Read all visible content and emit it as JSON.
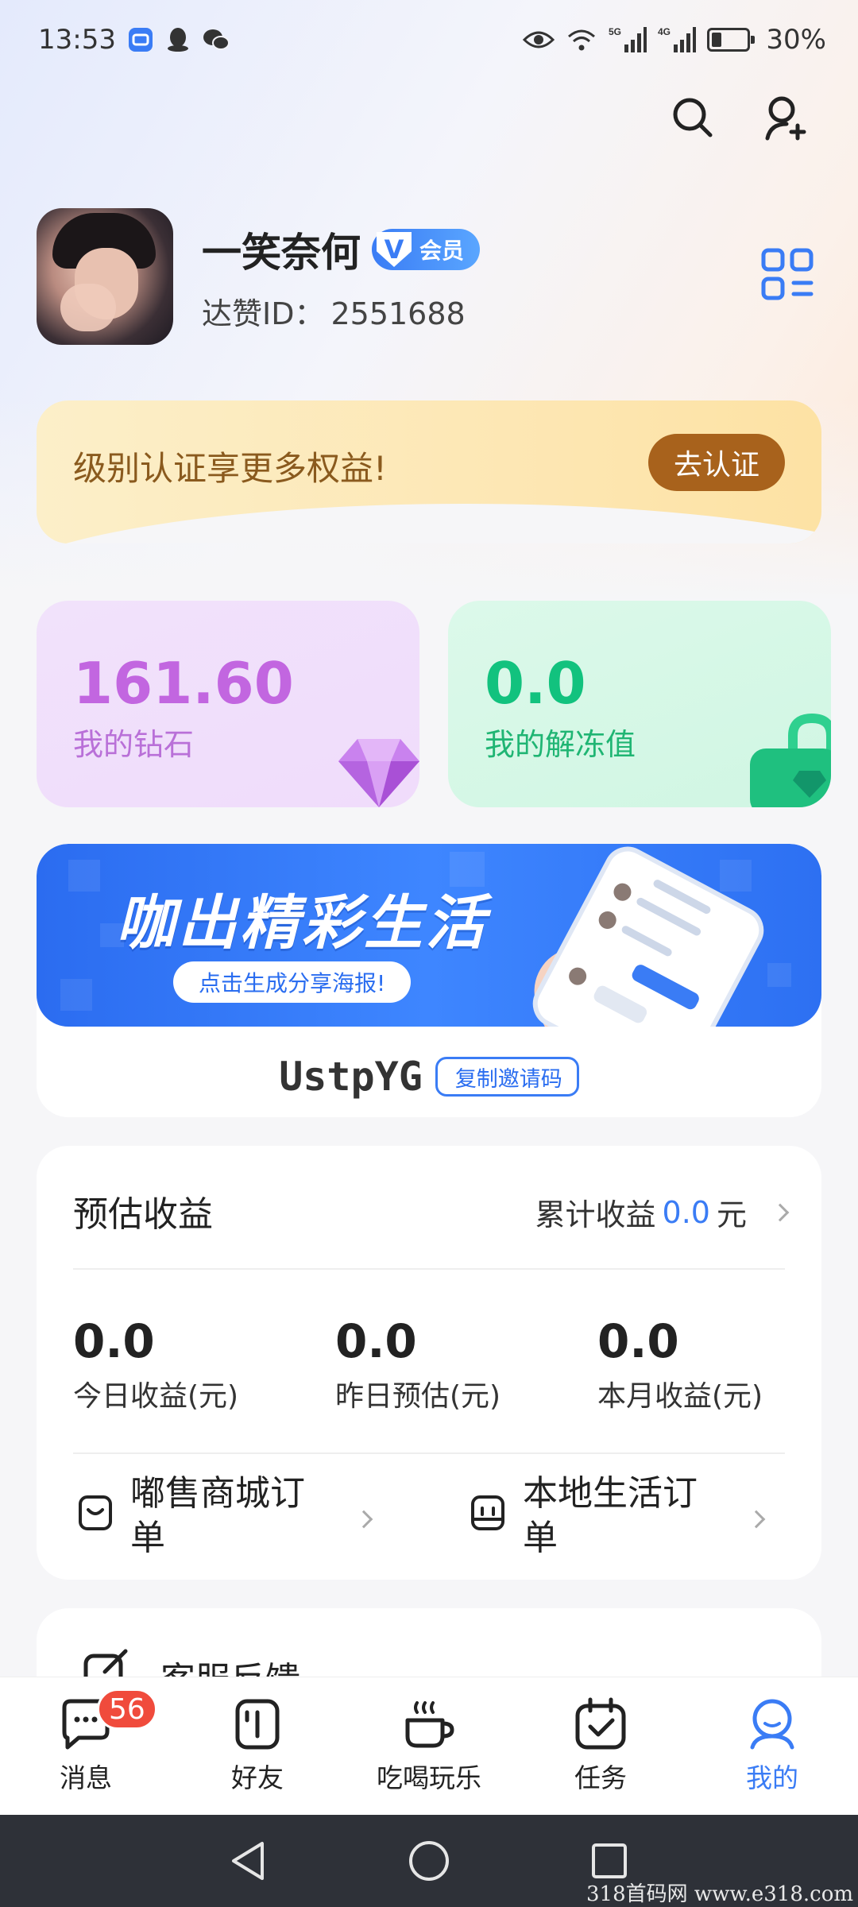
{
  "status_bar": {
    "time": "13:53",
    "network_5g": "5G",
    "network_4g": "4G",
    "battery": "30%"
  },
  "profile": {
    "name": "一笑奈何",
    "vip_badge": "会员",
    "vip_letter": "V",
    "id_label": "达赞ID：",
    "id_value": "2551688"
  },
  "cert_banner": {
    "text": "级别认证享更多权益!",
    "button": "去认证"
  },
  "assets": {
    "diamond_value": "161.60",
    "diamond_label": "我的钻石",
    "unfreeze_value": "0.0",
    "unfreeze_label": "我的解冻值"
  },
  "share": {
    "headline": "咖出精彩生活",
    "sub_button": "点击生成分享海报!",
    "invite_code": "UstpYG",
    "copy_button": "复制邀请码"
  },
  "earnings": {
    "title": "预估收益",
    "total_label": "累计收益",
    "total_value": "0.0",
    "total_unit": "元",
    "stats": [
      {
        "value": "0.0",
        "label": "今日收益(元)"
      },
      {
        "value": "0.0",
        "label": "昨日预估(元)"
      },
      {
        "value": "0.0",
        "label": "本月收益(元)"
      }
    ],
    "orders": [
      {
        "label": "嘟售商城订单"
      },
      {
        "label": "本地生活订单"
      }
    ]
  },
  "next_card": {
    "label": "客服反馈"
  },
  "tabs": [
    {
      "label": "消息",
      "icon": "chat-icon",
      "badge": "56"
    },
    {
      "label": "好友",
      "icon": "friends-icon"
    },
    {
      "label": "吃喝玩乐",
      "icon": "coffee-cup-icon"
    },
    {
      "label": "任务",
      "icon": "calendar-check-icon"
    },
    {
      "label": "我的",
      "icon": "profile-icon",
      "active": true
    }
  ],
  "watermark": "318首码网 www.e318.com",
  "colors": {
    "accent": "#3a7cf5",
    "diamond": "#c266e0",
    "unfreeze": "#12c27e",
    "cert_button": "#a8621c",
    "badge": "#f04b3c"
  }
}
